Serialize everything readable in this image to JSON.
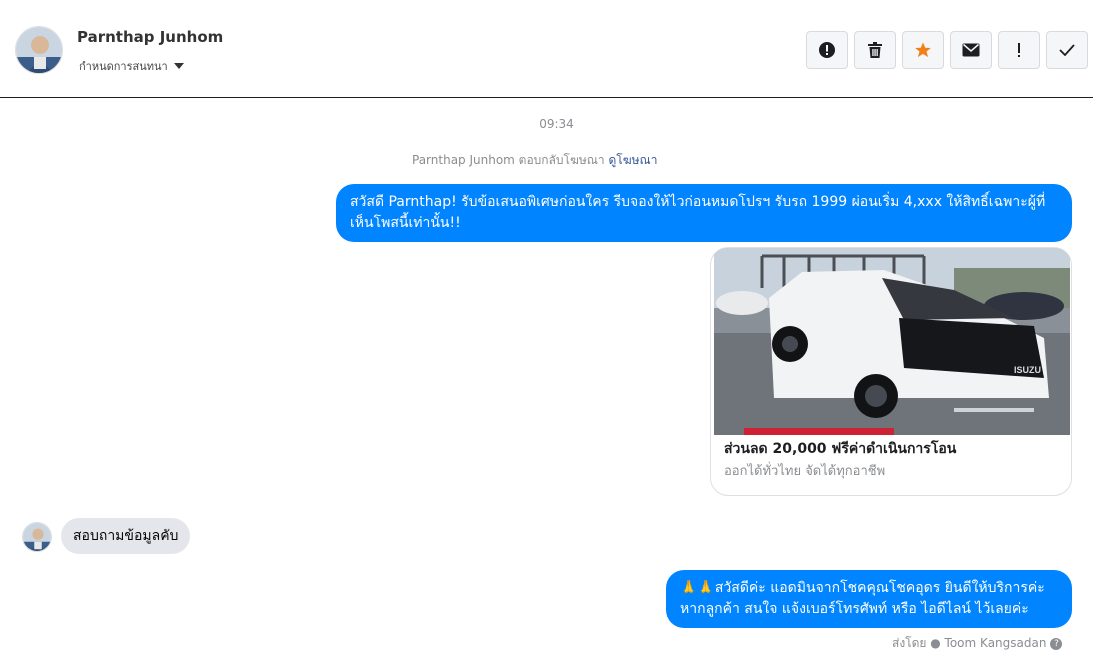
{
  "header": {
    "name": "Parnthap Junhom",
    "sub_label": "กำหนดการสนทนา",
    "caret_icon": "caret-down-icon"
  },
  "toolbar": {
    "buttons": [
      {
        "icon": "exclamation-circle-icon",
        "label": "!"
      },
      {
        "icon": "trash-icon"
      },
      {
        "icon": "star-icon",
        "color": "#f0801a"
      },
      {
        "icon": "envelope-icon"
      },
      {
        "icon": "exclamation-icon",
        "label": "!"
      },
      {
        "icon": "check-icon"
      }
    ]
  },
  "conversation": {
    "time": "09:34",
    "reply_note": "Parnthap Junhom ตอบกลับโฆษณา",
    "reply_link": "ดูโฆษณา",
    "messages": [
      {
        "direction": "out",
        "text": "สวัสดี Parnthap! รับข้อเสนอพิเศษก่อนใคร รีบจองให้ไวก่อนหมดโปรฯ รับรถ 1999 ผ่อนเริ่ม 4,xxx ให้สิทธิ์เฉพาะผู้ที่เห็นโพสนี้เท่านั้น!!"
      },
      {
        "direction": "out",
        "type": "card",
        "title": "ส่วนลด 20,000 ฟรีค่าดำเนินการโอน",
        "subtitle": "ออกได้ทั่วไทย จัดได้ทุกอาชีพ",
        "image_brand_text": "ISUZU"
      },
      {
        "direction": "in",
        "text": "สอบถามข้อมูลคับ"
      },
      {
        "direction": "out",
        "text": "🙏🙏สวัสดีค่ะ แอดมินจากโชคคุณโชคอุดร ยินดีให้บริการค่ะ หากลูกค้า สนใจ แจ้งเบอร์โทรศัพท์ หรือ ไอดีไลน์  ไว้เลยค่ะ"
      }
    ],
    "sent_by": "ส่งโดย ● Toom Kangsadan"
  },
  "colors": {
    "accent": "#0084ff",
    "incoming_bubble": "#e4e6eb",
    "star": "#f0801a"
  }
}
